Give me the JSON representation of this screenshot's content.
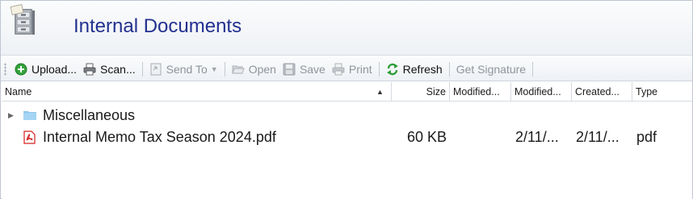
{
  "header": {
    "title": "Internal Documents",
    "icon": "file-cabinet-icon"
  },
  "toolbar": {
    "upload_label": "Upload...",
    "scan_label": "Scan...",
    "send_to_label": "Send To",
    "open_label": "Open",
    "save_label": "Save",
    "print_label": "Print",
    "refresh_label": "Refresh",
    "get_signature_label": "Get Signature"
  },
  "columns": {
    "name": "Name",
    "size": "Size",
    "modified_by": "Modified...",
    "modified_at": "Modified...",
    "created": "Created...",
    "type": "Type"
  },
  "rows": [
    {
      "kind": "folder",
      "name": "Miscellaneous",
      "size": "",
      "modified_by": "",
      "modified_at": "",
      "created": "",
      "type": ""
    },
    {
      "kind": "pdf",
      "name": "Internal Memo Tax Season 2024.pdf",
      "size": "60 KB",
      "modified_by": "",
      "modified_at": "2/11/...",
      "created": "2/11/...",
      "type": "pdf"
    }
  ],
  "colors": {
    "title": "#22318f",
    "folder": "#8cc6ee",
    "pdf": "#d32020",
    "refresh": "#2e9e3a",
    "upload": "#35a23c"
  }
}
